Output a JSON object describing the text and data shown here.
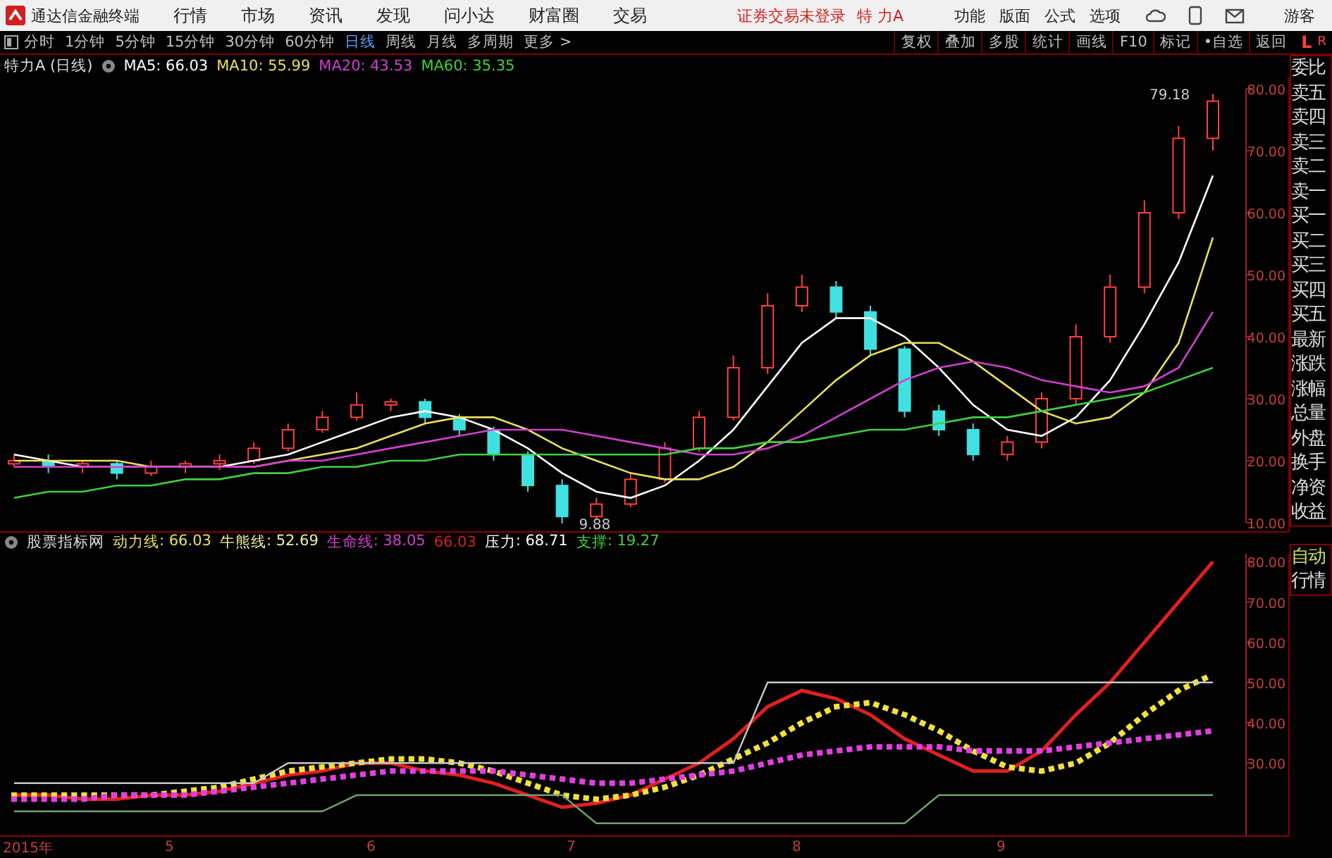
{
  "menu_bar": {
    "app_title": "通达信金融终端",
    "menus": [
      "行情",
      "市场",
      "资讯",
      "发现",
      "问小达",
      "财富圈",
      "交易"
    ],
    "login_notice": "证券交易未登录",
    "stock_name": "特 力A",
    "right_menus": [
      "功能",
      "版面",
      "公式",
      "选项"
    ],
    "user": "游客"
  },
  "toolbar": {
    "periods": [
      {
        "label": "分时",
        "selected": false
      },
      {
        "label": "1分钟",
        "selected": false
      },
      {
        "label": "5分钟",
        "selected": false
      },
      {
        "label": "15分钟",
        "selected": false
      },
      {
        "label": "30分钟",
        "selected": false
      },
      {
        "label": "60分钟",
        "selected": false
      },
      {
        "label": "日线",
        "selected": true
      },
      {
        "label": "周线",
        "selected": false
      },
      {
        "label": "月线",
        "selected": false
      },
      {
        "label": "多周期",
        "selected": false
      },
      {
        "label": "更多 >",
        "selected": false
      }
    ],
    "buttons": [
      "复权",
      "叠加",
      "多股",
      "统计",
      "画线",
      "F10",
      "标记",
      "•自选",
      "返回"
    ],
    "corner_marks": [
      "L",
      "R"
    ]
  },
  "main_chart": {
    "title": "特力A (日线)",
    "legend_values": [
      ": 66.03",
      ": 55.99",
      ": 43.53",
      ": 35.35"
    ],
    "high_marker": "79.18",
    "low_marker": "9.88",
    "chart_data": {
      "type": "candlestick",
      "ohlc": [
        [
          19.5,
          21,
          19,
          20
        ],
        [
          20,
          21,
          18,
          19
        ],
        [
          19,
          20,
          18,
          19.5
        ],
        [
          19.5,
          20,
          17,
          18
        ],
        [
          18,
          20,
          17.5,
          19
        ],
        [
          19,
          20,
          18,
          19.5
        ],
        [
          19.5,
          21,
          18.5,
          20
        ],
        [
          20,
          23,
          19.5,
          22
        ],
        [
          22,
          26,
          21.5,
          25
        ],
        [
          25,
          28,
          24.5,
          27
        ],
        [
          27,
          31,
          26.5,
          29
        ],
        [
          29,
          30,
          28,
          29.5
        ],
        [
          29.5,
          30,
          26,
          27
        ],
        [
          27,
          27.5,
          24,
          25
        ],
        [
          25,
          25.5,
          20,
          21
        ],
        [
          21,
          21.5,
          15,
          16
        ],
        [
          16,
          17,
          9.88,
          11
        ],
        [
          11,
          14,
          10.5,
          13
        ],
        [
          13,
          18,
          12.5,
          17
        ],
        [
          17,
          23,
          16.5,
          22
        ],
        [
          22,
          28,
          21.5,
          27
        ],
        [
          27,
          37,
          26.5,
          35
        ],
        [
          35,
          47,
          34,
          45
        ],
        [
          45,
          50,
          44,
          48
        ],
        [
          48,
          49,
          43,
          44
        ],
        [
          44,
          45,
          37,
          38
        ],
        [
          38,
          38.5,
          27,
          28
        ],
        [
          28,
          29,
          24,
          25
        ],
        [
          25,
          26,
          20,
          21
        ],
        [
          21,
          24,
          20,
          23
        ],
        [
          23,
          31,
          22,
          30
        ],
        [
          30,
          42,
          29,
          40
        ],
        [
          40,
          50,
          39,
          48
        ],
        [
          48,
          62,
          47,
          60
        ],
        [
          60,
          74,
          59,
          72
        ],
        [
          72,
          79.18,
          70,
          78
        ]
      ]
    }
  },
  "moving_averages": {
    "chart_data": {
      "type": "line",
      "ylim": [
        10,
        80
      ],
      "yticks": [
        {
          "value": 80,
          "label": "80.00"
        },
        {
          "value": 70,
          "label": "70.00"
        },
        {
          "value": 60,
          "label": "60.00"
        },
        {
          "value": 50,
          "label": "50.00"
        },
        {
          "value": 40,
          "label": "40.00"
        },
        {
          "value": 30,
          "label": "30.00"
        },
        {
          "value": 20,
          "label": "20.00"
        },
        {
          "value": 10,
          "label": "10.00"
        }
      ],
      "series": [
        {
          "name": "MA5",
          "color": "#ffffff",
          "values": [
            21,
            20,
            19,
            19,
            19,
            19,
            19,
            20,
            21,
            23,
            25,
            27,
            28,
            27,
            25,
            22,
            18,
            15,
            14,
            16,
            20,
            25,
            32,
            39,
            43,
            43,
            40,
            35,
            29,
            25,
            24,
            27,
            33,
            42,
            52,
            66
          ]
        },
        {
          "name": "MA10",
          "color": "#e8e060",
          "values": [
            20,
            20,
            20,
            20,
            19,
            19,
            19,
            19,
            20,
            21,
            22,
            24,
            26,
            27,
            27,
            25,
            22,
            20,
            18,
            17,
            17,
            19,
            23,
            28,
            33,
            37,
            39,
            39,
            36,
            32,
            28,
            26,
            27,
            31,
            39,
            56
          ]
        },
        {
          "name": "MA20",
          "color": "#d040d0",
          "values": [
            19,
            19,
            19,
            19,
            19,
            19,
            19,
            19,
            20,
            20,
            21,
            22,
            23,
            24,
            25,
            25,
            25,
            24,
            23,
            22,
            21,
            21,
            22,
            24,
            27,
            30,
            33,
            35,
            36,
            35,
            33,
            32,
            31,
            32,
            35,
            44
          ]
        },
        {
          "name": "MA60",
          "color": "#40d040",
          "values": [
            14,
            15,
            15,
            16,
            16,
            17,
            17,
            18,
            18,
            19,
            19,
            20,
            20,
            21,
            21,
            21,
            21,
            21,
            21,
            21,
            22,
            22,
            23,
            23,
            24,
            25,
            25,
            26,
            27,
            27,
            28,
            29,
            30,
            31,
            33,
            35
          ]
        }
      ]
    }
  },
  "indicator_chart": {
    "title": "股票指标网",
    "legend_values": [
      {
        "value": ": 66.03",
        "color": "#e8e060"
      },
      {
        "value": ": 52.69",
        "color": "#f0f0a0"
      },
      {
        "value": ": 38.05",
        "color": "#d040d0"
      },
      {
        "value": ": 68.71",
        "color": "#ffffff"
      },
      {
        "value": ": 19.27",
        "color": "#40d040"
      }
    ],
    "extra_value": "66.03",
    "chart_data": {
      "type": "line",
      "ylim": [
        12,
        82
      ],
      "yticks": [
        {
          "value": 80,
          "label": "80.00"
        },
        {
          "value": 70,
          "label": "70.00"
        },
        {
          "value": 60,
          "label": "60.00"
        },
        {
          "value": 50,
          "label": "50.00"
        },
        {
          "value": 40,
          "label": "40.00"
        },
        {
          "value": 30,
          "label": "30.00"
        }
      ],
      "series": [
        {
          "name": "动力线",
          "color": "#e02020",
          "values": [
            22,
            22,
            21,
            21,
            22,
            22,
            23,
            25,
            27,
            28,
            30,
            30,
            28,
            27,
            25,
            22,
            19,
            20,
            22,
            26,
            30,
            36,
            44,
            48,
            46,
            42,
            36,
            32,
            28,
            28,
            33,
            42,
            50,
            60,
            70,
            80
          ]
        },
        {
          "name": "牛熊线",
          "color": "#f0e040",
          "line_style": "dotted",
          "values": [
            22,
            22,
            22,
            22,
            22,
            23,
            24,
            26,
            28,
            29,
            30,
            31,
            31,
            30,
            28,
            25,
            22,
            21,
            22,
            24,
            27,
            31,
            35,
            40,
            44,
            45,
            42,
            38,
            33,
            29,
            28,
            30,
            35,
            42,
            48,
            52
          ]
        },
        {
          "name": "生命线",
          "color": "#e040e0",
          "line_style": "dotted",
          "values": [
            21,
            21,
            21,
            22,
            22,
            22,
            23,
            24,
            25,
            26,
            27,
            28,
            28,
            28,
            28,
            27,
            26,
            25,
            25,
            26,
            27,
            28,
            30,
            32,
            33,
            34,
            34,
            34,
            33,
            33,
            33,
            34,
            35,
            36,
            37,
            38
          ]
        },
        {
          "name": "压力",
          "color": "#c8c8c8",
          "values": [
            25,
            25,
            25,
            25,
            25,
            25,
            25,
            25,
            30,
            30,
            30,
            30,
            30,
            30,
            30,
            30,
            30,
            30,
            30,
            30,
            30,
            30,
            50,
            50,
            50,
            50,
            50,
            50,
            50,
            50,
            50,
            50,
            50,
            50,
            50,
            50
          ]
        },
        {
          "name": "支撑",
          "color": "#70a070",
          "values": [
            18,
            18,
            18,
            18,
            18,
            18,
            18,
            18,
            18,
            18,
            22,
            22,
            22,
            22,
            22,
            22,
            22,
            15,
            15,
            15,
            15,
            15,
            15,
            15,
            15,
            15,
            15,
            22,
            22,
            22,
            22,
            22,
            22,
            22,
            22,
            22
          ]
        }
      ]
    }
  },
  "x_axis": [
    "2015年",
    "5",
    "6",
    "7",
    "8",
    "9"
  ],
  "sidebar": {
    "items": [
      "委比",
      "卖五",
      "卖四",
      "卖三",
      "卖二",
      "卖一",
      "买一",
      "买二",
      "买三",
      "买四",
      "买五",
      "最新",
      "涨跌",
      "涨幅",
      "总量",
      "外盘",
      "换手",
      "净资",
      "收益"
    ],
    "bottom_items": [
      "自动",
      "行情"
    ]
  }
}
